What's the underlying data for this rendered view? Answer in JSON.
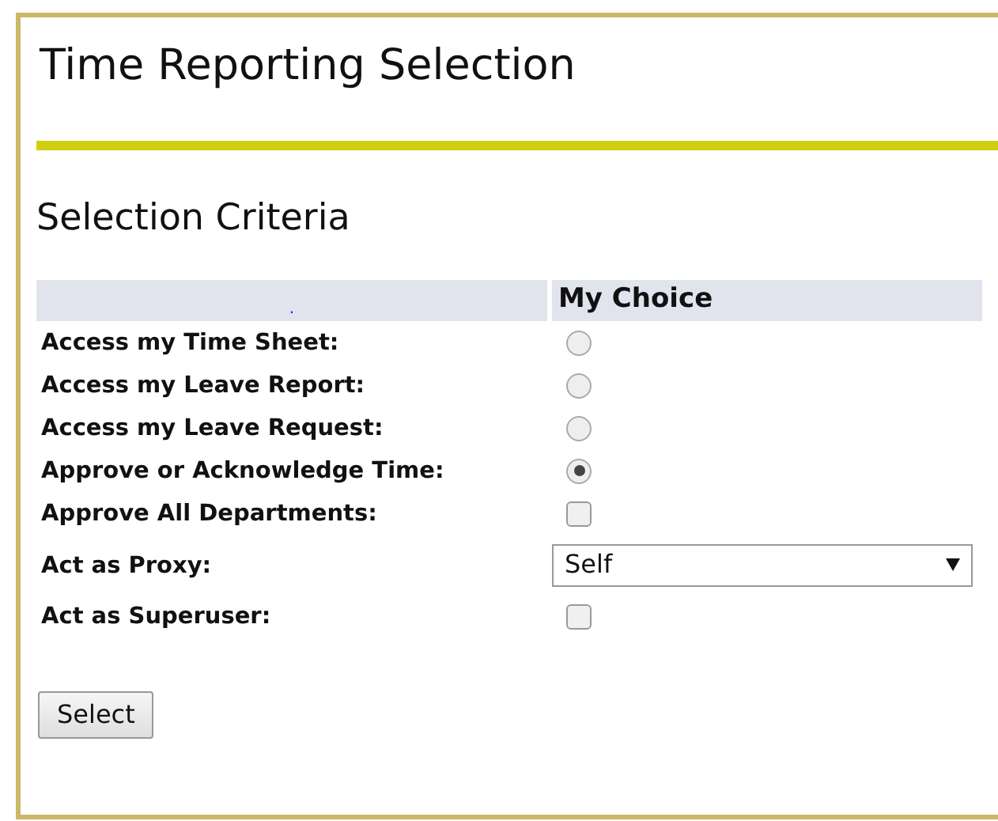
{
  "page": {
    "title": "Time Reporting Selection"
  },
  "section": {
    "heading": "Selection Criteria"
  },
  "table": {
    "columns": [
      ".",
      "My Choice"
    ],
    "rows": [
      {
        "label": "Access my Time Sheet:",
        "kind": "radio",
        "selected": false
      },
      {
        "label": "Access my Leave Report:",
        "kind": "radio",
        "selected": false
      },
      {
        "label": "Access my Leave Request:",
        "kind": "radio",
        "selected": false
      },
      {
        "label": "Approve or Acknowledge Time:",
        "kind": "radio",
        "selected": true
      },
      {
        "label": "Approve All Departments:",
        "kind": "checkbox",
        "checked": false
      },
      {
        "label": "Act as Proxy:",
        "kind": "select",
        "value": "Self"
      },
      {
        "label": "Act as Superuser:",
        "kind": "checkbox",
        "checked": false
      }
    ]
  },
  "buttons": [
    "Select"
  ]
}
